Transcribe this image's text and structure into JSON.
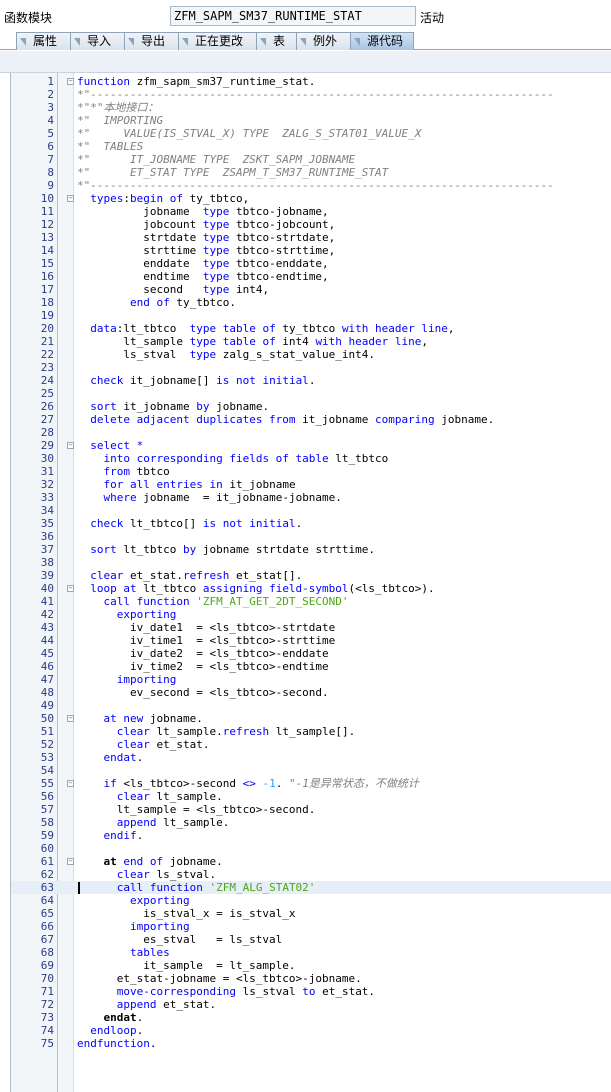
{
  "header": {
    "label": "函数模块",
    "name": "ZFM_SAPM_SM37_RUNTIME_STAT",
    "status": "活动"
  },
  "tabs": [
    {
      "label": "属性",
      "active": false
    },
    {
      "label": "导入",
      "active": false
    },
    {
      "label": "导出",
      "active": false
    },
    {
      "label": "正在更改",
      "active": false
    },
    {
      "label": "表",
      "active": false
    },
    {
      "label": "例外",
      "active": false
    },
    {
      "label": "源代码",
      "active": true
    }
  ],
  "colors": {
    "keyword": "#0000ff",
    "comment": "#808080",
    "string": "#4da619",
    "number": "#3399ff"
  },
  "editor": {
    "current_line": 63,
    "fold_markers": [
      1,
      10,
      29,
      40,
      50,
      55,
      61
    ],
    "lines": [
      [
        [
          "kw",
          "function"
        ],
        [
          "t",
          " zfm_sapm_sm37_runtime_stat."
        ]
      ],
      [
        [
          "cm",
          "*\"----------------------------------------------------------------------"
        ]
      ],
      [
        [
          "cm",
          "*\"*\"本地接口："
        ]
      ],
      [
        [
          "cm",
          "*\"  IMPORTING"
        ]
      ],
      [
        [
          "cm",
          "*\"     VALUE(IS_STVAL_X) TYPE  ZALG_S_STAT01_VALUE_X"
        ]
      ],
      [
        [
          "cm",
          "*\"  TABLES"
        ]
      ],
      [
        [
          "cm",
          "*\"      IT_JOBNAME TYPE  ZSKT_SAPM_JOBNAME"
        ]
      ],
      [
        [
          "cm",
          "*\"      ET_STAT TYPE  ZSAPM_T_SM37_RUNTIME_STAT"
        ]
      ],
      [
        [
          "cm",
          "*\"----------------------------------------------------------------------"
        ]
      ],
      [
        [
          "t",
          "  "
        ],
        [
          "kw",
          "types"
        ],
        [
          "t",
          ":"
        ],
        [
          "kw",
          "begin of"
        ],
        [
          "t",
          " ty_tbtco,"
        ]
      ],
      [
        [
          "t",
          "          jobname  "
        ],
        [
          "kw",
          "type"
        ],
        [
          "t",
          " tbtco-jobname,"
        ]
      ],
      [
        [
          "t",
          "          jobcount "
        ],
        [
          "kw",
          "type"
        ],
        [
          "t",
          " tbtco-jobcount,"
        ]
      ],
      [
        [
          "t",
          "          strtdate "
        ],
        [
          "kw",
          "type"
        ],
        [
          "t",
          " tbtco-strtdate,"
        ]
      ],
      [
        [
          "t",
          "          strttime "
        ],
        [
          "kw",
          "type"
        ],
        [
          "t",
          " tbtco-strttime,"
        ]
      ],
      [
        [
          "t",
          "          enddate  "
        ],
        [
          "kw",
          "type"
        ],
        [
          "t",
          " tbtco-enddate,"
        ]
      ],
      [
        [
          "t",
          "          endtime  "
        ],
        [
          "kw",
          "type"
        ],
        [
          "t",
          " tbtco-endtime,"
        ]
      ],
      [
        [
          "t",
          "          second   "
        ],
        [
          "kw",
          "type"
        ],
        [
          "t",
          " int4,"
        ]
      ],
      [
        [
          "t",
          "        "
        ],
        [
          "kw",
          "end of"
        ],
        [
          "t",
          " ty_tbtco."
        ]
      ],
      [
        [
          "t",
          ""
        ]
      ],
      [
        [
          "t",
          "  "
        ],
        [
          "kw",
          "data"
        ],
        [
          "t",
          ":lt_tbtco  "
        ],
        [
          "kw",
          "type table of"
        ],
        [
          "t",
          " ty_tbtco "
        ],
        [
          "kw",
          "with header line"
        ],
        [
          "t",
          ","
        ]
      ],
      [
        [
          "t",
          "       lt_sample "
        ],
        [
          "kw",
          "type table of"
        ],
        [
          "t",
          " int4 "
        ],
        [
          "kw",
          "with header line"
        ],
        [
          "t",
          ","
        ]
      ],
      [
        [
          "t",
          "       ls_stval  "
        ],
        [
          "kw",
          "type"
        ],
        [
          "t",
          " zalg_s_stat_value_int4."
        ]
      ],
      [
        [
          "t",
          ""
        ]
      ],
      [
        [
          "t",
          "  "
        ],
        [
          "kw",
          "check"
        ],
        [
          "t",
          " it_jobname[] "
        ],
        [
          "kw",
          "is not initial"
        ],
        [
          "t",
          "."
        ]
      ],
      [
        [
          "t",
          ""
        ]
      ],
      [
        [
          "t",
          "  "
        ],
        [
          "kw",
          "sort"
        ],
        [
          "t",
          " it_jobname "
        ],
        [
          "kw",
          "by"
        ],
        [
          "t",
          " jobname."
        ]
      ],
      [
        [
          "t",
          "  "
        ],
        [
          "kw",
          "delete adjacent duplicates from"
        ],
        [
          "t",
          " it_jobname "
        ],
        [
          "kw",
          "comparing"
        ],
        [
          "t",
          " jobname."
        ]
      ],
      [
        [
          "t",
          ""
        ]
      ],
      [
        [
          "t",
          "  "
        ],
        [
          "kw",
          "select"
        ],
        [
          "t",
          " "
        ],
        [
          "kw",
          "*"
        ]
      ],
      [
        [
          "t",
          "    "
        ],
        [
          "kw",
          "into corresponding fields of table"
        ],
        [
          "t",
          " lt_tbtco"
        ]
      ],
      [
        [
          "t",
          "    "
        ],
        [
          "kw",
          "from"
        ],
        [
          "t",
          " tbtco"
        ]
      ],
      [
        [
          "t",
          "    "
        ],
        [
          "kw",
          "for all entries in"
        ],
        [
          "t",
          " it_jobname"
        ]
      ],
      [
        [
          "t",
          "    "
        ],
        [
          "kw",
          "where"
        ],
        [
          "t",
          " jobname  = it_jobname-jobname."
        ]
      ],
      [
        [
          "t",
          ""
        ]
      ],
      [
        [
          "t",
          "  "
        ],
        [
          "kw",
          "check"
        ],
        [
          "t",
          " lt_tbtco[] "
        ],
        [
          "kw",
          "is not initial"
        ],
        [
          "t",
          "."
        ]
      ],
      [
        [
          "t",
          ""
        ]
      ],
      [
        [
          "t",
          "  "
        ],
        [
          "kw",
          "sort"
        ],
        [
          "t",
          " lt_tbtco "
        ],
        [
          "kw",
          "by"
        ],
        [
          "t",
          " jobname strtdate strttime."
        ]
      ],
      [
        [
          "t",
          ""
        ]
      ],
      [
        [
          "t",
          "  "
        ],
        [
          "kw",
          "clear"
        ],
        [
          "t",
          " et_stat."
        ],
        [
          "kw",
          "refresh"
        ],
        [
          "t",
          " et_stat[]."
        ]
      ],
      [
        [
          "t",
          "  "
        ],
        [
          "kw",
          "loop at"
        ],
        [
          "t",
          " lt_tbtco "
        ],
        [
          "kw",
          "assigning field-symbol"
        ],
        [
          "t",
          "(<ls_tbtco>)."
        ]
      ],
      [
        [
          "t",
          "    "
        ],
        [
          "kw",
          "call function"
        ],
        [
          "t",
          " "
        ],
        [
          "st",
          "'ZFM_AT_GET_2DT_SECOND'"
        ]
      ],
      [
        [
          "t",
          "      "
        ],
        [
          "kw",
          "exporting"
        ]
      ],
      [
        [
          "t",
          "        iv_date1  = <ls_tbtco>-strtdate"
        ]
      ],
      [
        [
          "t",
          "        iv_time1  = <ls_tbtco>-strttime"
        ]
      ],
      [
        [
          "t",
          "        iv_date2  = <ls_tbtco>-enddate"
        ]
      ],
      [
        [
          "t",
          "        iv_time2  = <ls_tbtco>-endtime"
        ]
      ],
      [
        [
          "t",
          "      "
        ],
        [
          "kw",
          "importing"
        ]
      ],
      [
        [
          "t",
          "        ev_second = <ls_tbtco>-second."
        ]
      ],
      [
        [
          "t",
          ""
        ]
      ],
      [
        [
          "t",
          "    "
        ],
        [
          "kw",
          "at new"
        ],
        [
          "t",
          " jobname."
        ]
      ],
      [
        [
          "t",
          "      "
        ],
        [
          "kw",
          "clear"
        ],
        [
          "t",
          " lt_sample."
        ],
        [
          "kw",
          "refresh"
        ],
        [
          "t",
          " lt_sample[]."
        ]
      ],
      [
        [
          "t",
          "      "
        ],
        [
          "kw",
          "clear"
        ],
        [
          "t",
          " et_stat."
        ]
      ],
      [
        [
          "t",
          "    "
        ],
        [
          "kw",
          "endat"
        ],
        [
          "t",
          "."
        ]
      ],
      [
        [
          "t",
          ""
        ]
      ],
      [
        [
          "t",
          "    "
        ],
        [
          "kw",
          "if"
        ],
        [
          "t",
          " <ls_tbtco>-second "
        ],
        [
          "kw",
          "<>"
        ],
        [
          "t",
          " "
        ],
        [
          "nm",
          "-1"
        ],
        [
          "t",
          ". "
        ],
        [
          "cm",
          "\"-1是异常状态，不做统计"
        ]
      ],
      [
        [
          "t",
          "      "
        ],
        [
          "kw",
          "clear"
        ],
        [
          "t",
          " lt_sample."
        ]
      ],
      [
        [
          "t",
          "      lt_sample = <ls_tbtco>-second."
        ]
      ],
      [
        [
          "t",
          "      "
        ],
        [
          "kw",
          "append"
        ],
        [
          "t",
          " lt_sample."
        ]
      ],
      [
        [
          "t",
          "    "
        ],
        [
          "kw",
          "endif"
        ],
        [
          "t",
          "."
        ]
      ],
      [
        [
          "t",
          ""
        ]
      ],
      [
        [
          "t",
          "    "
        ],
        [
          "b",
          "at"
        ],
        [
          "t",
          " "
        ],
        [
          "kw",
          "end of"
        ],
        [
          "t",
          " jobname."
        ]
      ],
      [
        [
          "t",
          "      "
        ],
        [
          "kw",
          "clear"
        ],
        [
          "t",
          " ls_stval."
        ]
      ],
      [
        [
          "t",
          "      "
        ],
        [
          "kw",
          "call function"
        ],
        [
          "t",
          " "
        ],
        [
          "st",
          "'ZFM_ALG_STAT02'"
        ]
      ],
      [
        [
          "t",
          "        "
        ],
        [
          "kw",
          "exporting"
        ]
      ],
      [
        [
          "t",
          "          is_stval_x = is_stval_x"
        ]
      ],
      [
        [
          "t",
          "        "
        ],
        [
          "kw",
          "importing"
        ]
      ],
      [
        [
          "t",
          "          es_stval   = ls_stval"
        ]
      ],
      [
        [
          "t",
          "        "
        ],
        [
          "kw",
          "tables"
        ]
      ],
      [
        [
          "t",
          "          it_sample  = lt_sample."
        ]
      ],
      [
        [
          "t",
          "      et_stat-jobname = <ls_tbtco>-jobname."
        ]
      ],
      [
        [
          "t",
          "      "
        ],
        [
          "kw",
          "move-corresponding"
        ],
        [
          "t",
          " ls_stval "
        ],
        [
          "kw",
          "to"
        ],
        [
          "t",
          " et_stat."
        ]
      ],
      [
        [
          "t",
          "      "
        ],
        [
          "kw",
          "append"
        ],
        [
          "t",
          " et_stat."
        ]
      ],
      [
        [
          "t",
          "    "
        ],
        [
          "b",
          "endat"
        ],
        [
          "t",
          "."
        ]
      ],
      [
        [
          "t",
          "  "
        ],
        [
          "kw",
          "endloop"
        ],
        [
          "t",
          "."
        ]
      ],
      [
        [
          "kw",
          "endfunction"
        ],
        [
          "t",
          "."
        ]
      ]
    ]
  }
}
